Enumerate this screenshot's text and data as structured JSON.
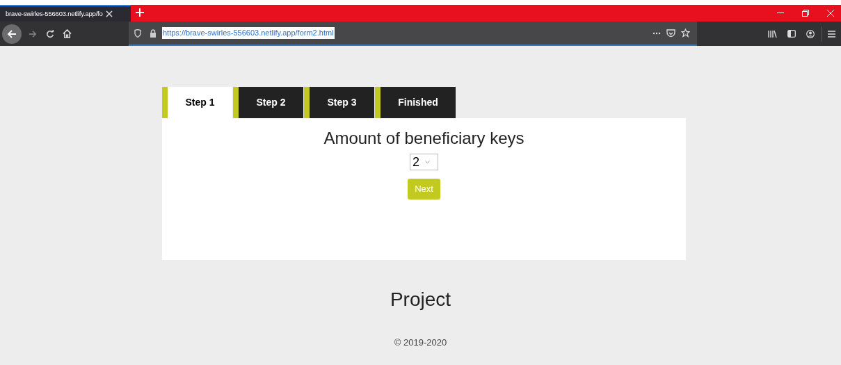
{
  "browser": {
    "tab_title": "brave-swirles-556603.netlify.app/fo",
    "url": "https://brave-swirles-556603.netlify.app/form2.html"
  },
  "steps": [
    {
      "label": "Step 1",
      "selected": true
    },
    {
      "label": "Step 2",
      "selected": false
    },
    {
      "label": "Step 3",
      "selected": false
    },
    {
      "label": "Finished",
      "selected": false
    }
  ],
  "form": {
    "heading": "Amount of beneficiary keys",
    "select_value": "2",
    "button": "Next"
  },
  "footer": {
    "title": "Project",
    "copyright": "© 2019-2020"
  }
}
